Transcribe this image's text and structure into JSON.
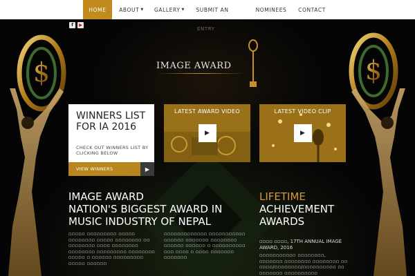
{
  "nav": {
    "items": [
      {
        "label": "HOME",
        "active": true
      },
      {
        "label": "ABOUT",
        "caret": true
      },
      {
        "label": "GALLERY",
        "caret": true
      },
      {
        "label": "SUBMIT AN",
        "continuation": "ENTRY"
      },
      {
        "label": "NOMINEES"
      },
      {
        "label": "CONTACT"
      }
    ],
    "accent_color": "#c08a1c"
  },
  "social": [
    {
      "icon": "facebook-icon",
      "glyph": "f"
    },
    {
      "icon": "youtube-icon",
      "glyph": "▶"
    }
  ],
  "logo": {
    "text": "IMAGE AWARD"
  },
  "winners_card": {
    "title": "WINNERS LIST FOR IA 2016",
    "subtitle": "CHECK OUT WINNERS LIST BY CLICKING BELOW",
    "button_label": "VIEW WINNERS",
    "button_icon": "play-arrow-icon"
  },
  "video_card": {
    "title": "LATEST AWARD VIDEO",
    "icon": "play-icon"
  },
  "clip_card": {
    "title": "LATEST VIDEO CLIP",
    "icon": "play-icon"
  },
  "intro": {
    "heading": "IMAGE AWARD\nNATION'S BIGGEST AWARD IN MUSIC INDUSTRY OF NEPAL",
    "body_left": "▫▫▫▫▫ ▫▫▫▫▫▫▫▫▫ ▫▫▫▫▫ ▫▫▫▫▫▫▫▫ ▫▫▫▫▫ ▫▫▫▫▫▫▫▫ ▫▫ ▫▫▫▫▫▫▫▫ ▫▫▫▫ ▫▫▫▫▫▫▫▫ ▫▫▫▫▫▫▫▫ ▫▫▫▫▫▫▫▫▫ ▫▫▫▫▫▫▫▫ ▫▫▫▫▫ ▫ ▫▫▫▫▫▫ ▫▫▫▫▫▫▫▫▫ ▫▫▫▫▫ ▫▫▫▫▫▫",
    "body_right": "▫▫▫▫▫▫▫▫▫▫▫▫▫ ▫▫▫▫▫▫▫▫▫▫▫ ▫▫▫▫▫▫ ▫▫▫▫▫▫▫ ▫▫▫▫▫▫▫▫ ▫▫▫▫▫▫ ▫▫▫▫▫▫ ▫ ▫▫▫▫▫▫▫▫▫▫ ▫▫▫ ▫▫▫▫ ▫ ▫▫▫▫ ▫▫▫▫▫▫▫ ▫▫▫▫▫▫▫"
  },
  "lifetime": {
    "heading_accent": "LIFETIME",
    "heading_rest": "ACHIEVEMENT AWARDS",
    "date_line": "▫▫▫▫ ▫▫▫▫, 17TH ANNUAL IMAGE AWARD, 2016",
    "body": "▫▫▫▫▫▫▫▫▫▫▫ ▫▫▫▫▫▫▫▫, ▫▫▫▫▫▫▫ ▫▫▫▫▫▫▫▫ ▫▫▫▫▫▫▫▫ ▫▫ ▫▫▫▫/▫▫▫▫▫▫▫▫/▫▫▫▫▫▫▫▫▫▫ ▫▫ ▫▫▫▫▫▫▫ ▫▫▫▫▫▫▫▫▫▫"
  }
}
